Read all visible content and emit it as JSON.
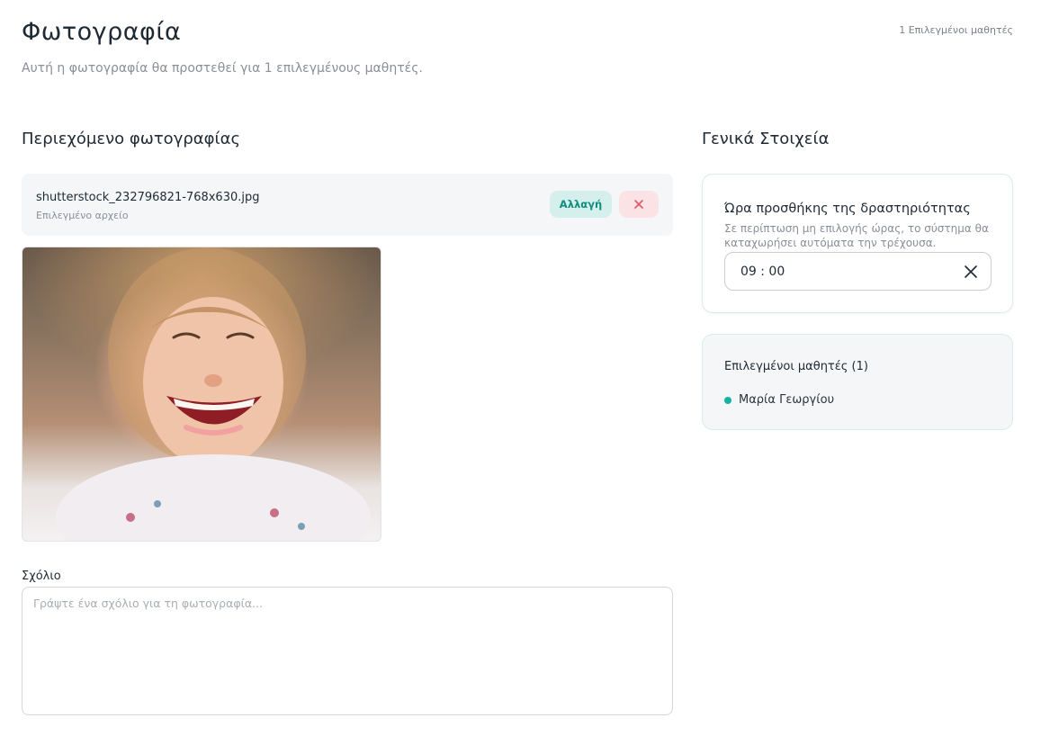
{
  "header": {
    "title": "Φωτογραφία",
    "subtitle": "Αυτή η φωτογραφία θα προστεθεί για 1 επιλεγμένους μαθητές.",
    "selected_count_label": "1 Επιλεγμένοι μαθητές"
  },
  "content": {
    "section_title": "Περιεχόμενο φωτογραφίας",
    "file": {
      "name": "shutterstock_232796821-768x630.jpg",
      "caption": "Επιλεγμένο αρχείο",
      "change_label": "Αλλαγή"
    },
    "comment": {
      "label": "Σχόλιο",
      "placeholder": "Γράψτε ένα σχόλιο για τη φωτογραφία...",
      "value": ""
    }
  },
  "general": {
    "section_title": "Γενικά Στοιχεία",
    "time": {
      "title": "Ώρα προσθήκης της δραστηριότητας",
      "description": "Σε περίπτωση μη επιλογής ώρας, το σύστημα θα καταχωρήσει αυτόματα την τρέχουσα.",
      "value": "09 : 00"
    },
    "students": {
      "title": "Επιλεγμένοι μαθητές (1)",
      "items": [
        {
          "name": "Μαρία Γεωργίου"
        }
      ]
    }
  },
  "colors": {
    "accent": "#14b3a3",
    "change_button_bg": "#d4efec",
    "remove_button_bg": "#fbe3e5",
    "remove_icon": "#e0566a"
  },
  "icons": {
    "remove": "close-icon",
    "clear_time": "close-icon",
    "student_bullet": "dot-icon"
  }
}
